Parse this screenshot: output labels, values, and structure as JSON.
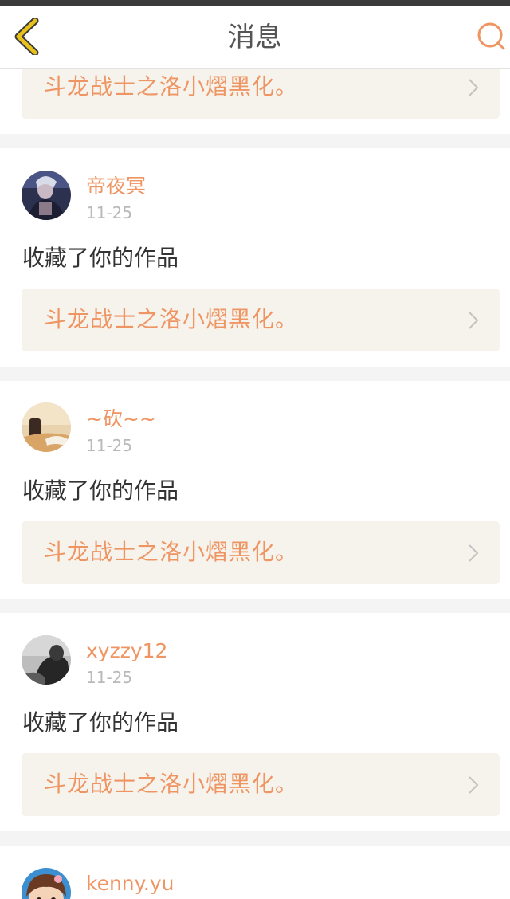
{
  "header": {
    "title": "消息",
    "back_icon": "chevron-left-icon",
    "search_icon": "search-icon"
  },
  "colors": {
    "accent": "#ef9563",
    "back_icon": "#e8c21a",
    "link_background": "#f5f3ec"
  },
  "partial_card": {
    "work_title": "斗龙战士之洛小熠黑化。"
  },
  "messages": [
    {
      "username": "帝夜冥",
      "time": "11-25",
      "action": "收藏了你的作品",
      "work_title": "斗龙战士之洛小熠黑化。"
    },
    {
      "username": "~砍~~",
      "time": "11-25",
      "action": "收藏了你的作品",
      "work_title": "斗龙战士之洛小熠黑化。"
    },
    {
      "username": "xyzzy12",
      "time": "11-25",
      "action": "收藏了你的作品",
      "work_title": "斗龙战士之洛小熠黑化。"
    },
    {
      "username": "kenny.yu"
    }
  ]
}
